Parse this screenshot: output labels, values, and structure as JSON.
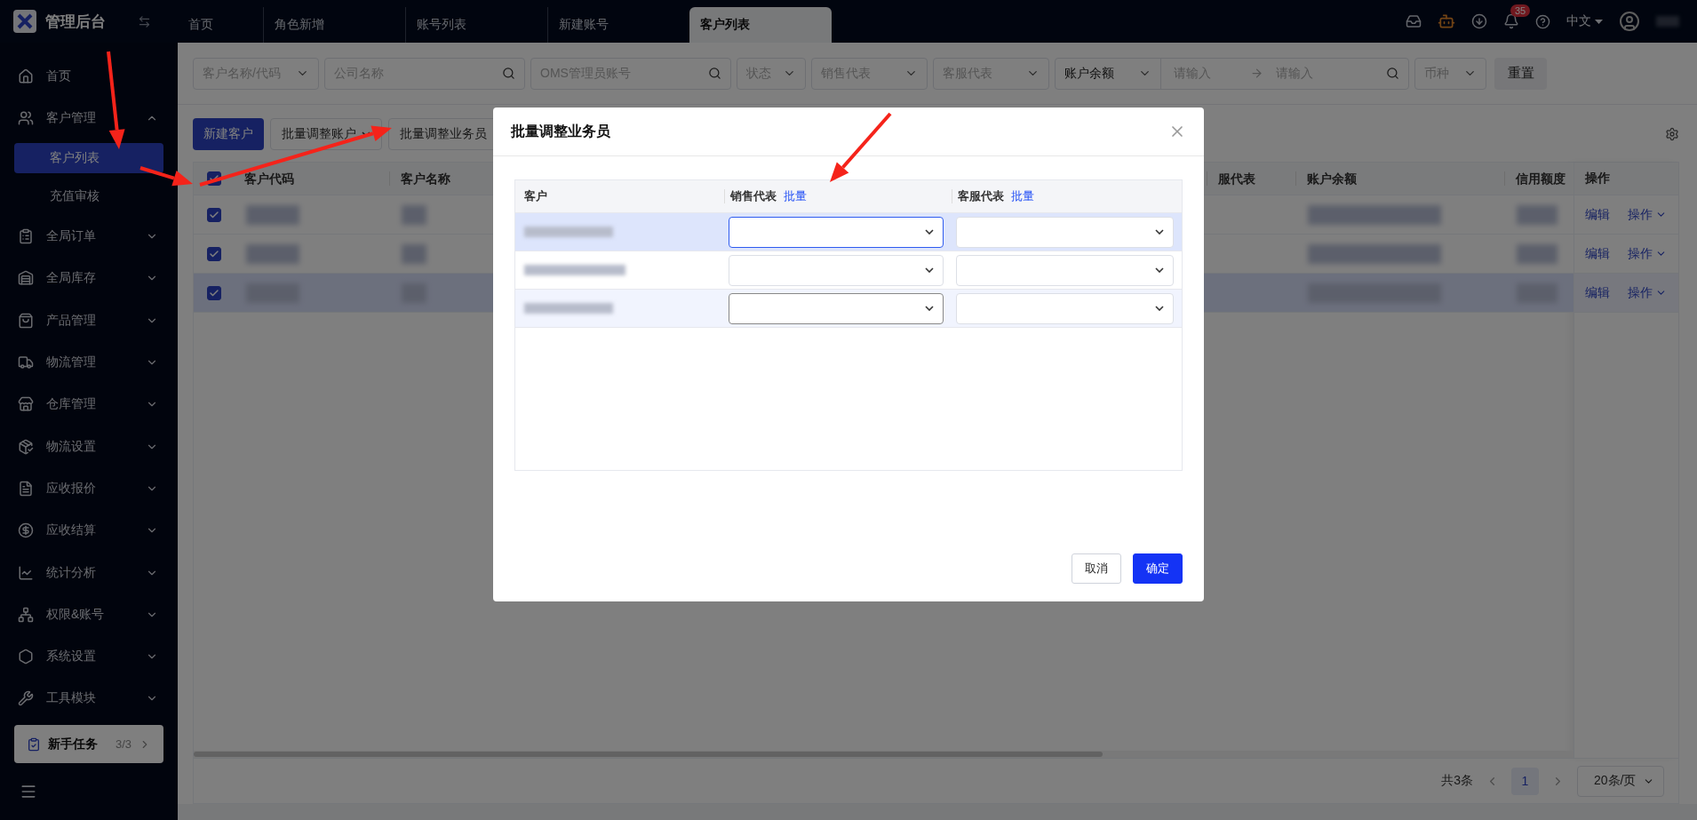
{
  "topbar": {
    "title": "管理后台",
    "tabs": [
      {
        "label": "首页",
        "selected": false
      },
      {
        "label": "角色新增",
        "selected": false
      },
      {
        "label": "账号列表",
        "selected": false
      },
      {
        "label": "新建账号",
        "selected": false
      },
      {
        "label": "客户列表",
        "selected": true
      }
    ],
    "notification_count": "35",
    "language": "中文"
  },
  "sidebar": {
    "items": [
      {
        "kind": "link",
        "label": "首页"
      },
      {
        "kind": "group",
        "label": "客户管理",
        "expanded": true,
        "children": [
          {
            "label": "客户列表",
            "selected": true
          },
          {
            "label": "充值审核",
            "selected": false
          }
        ]
      },
      {
        "kind": "group",
        "label": "全局订单",
        "expanded": false
      },
      {
        "kind": "group",
        "label": "全局库存",
        "expanded": false
      },
      {
        "kind": "group",
        "label": "产品管理",
        "expanded": false
      },
      {
        "kind": "group",
        "label": "物流管理",
        "expanded": false
      },
      {
        "kind": "group",
        "label": "仓库管理",
        "expanded": false
      },
      {
        "kind": "group",
        "label": "物流设置",
        "expanded": false
      },
      {
        "kind": "group",
        "label": "应收报价",
        "expanded": false
      },
      {
        "kind": "group",
        "label": "应收结算",
        "expanded": false
      },
      {
        "kind": "group",
        "label": "统计分析",
        "expanded": false
      },
      {
        "kind": "group",
        "label": "权限&账号",
        "expanded": false
      },
      {
        "kind": "group",
        "label": "系统设置",
        "expanded": false
      },
      {
        "kind": "group",
        "label": "工具模块",
        "expanded": false
      }
    ],
    "task": {
      "label": "新手任务",
      "progress": "3/3"
    }
  },
  "filters": [
    {
      "kind": "select",
      "placeholder": "客户名称/代码"
    },
    {
      "kind": "search",
      "placeholder": "公司名称"
    },
    {
      "kind": "search",
      "placeholder": "OMS管理员账号"
    },
    {
      "kind": "select",
      "placeholder": "状态"
    },
    {
      "kind": "select",
      "placeholder": "销售代表"
    },
    {
      "kind": "select",
      "placeholder": "客服代表"
    },
    {
      "kind": "range",
      "value": "账户余额",
      "from_placeholder": "请输入",
      "to_placeholder": "请输入"
    },
    {
      "kind": "select",
      "placeholder": "币种"
    }
  ],
  "reset_button": "重置",
  "toolbar": [
    {
      "kind": "primary",
      "label": "新建客户"
    },
    {
      "kind": "dropdown",
      "label": "批量调整账户"
    },
    {
      "kind": "plain",
      "label": "批量调整业务员"
    }
  ],
  "table": {
    "all_checked": true,
    "columns": [
      "客户代码",
      "客户名称",
      "服代表",
      "账户余额",
      "信用额度"
    ],
    "action_column": "操作",
    "rows": [
      {
        "checked": true,
        "hovered": false,
        "actions": [
          "编辑",
          "操作"
        ]
      },
      {
        "checked": true,
        "hovered": false,
        "actions": [
          "编辑",
          "操作"
        ]
      },
      {
        "checked": true,
        "hovered": true,
        "actions": [
          "编辑",
          "操作"
        ]
      }
    ]
  },
  "pagination": {
    "total": "共3条",
    "pages": [
      {
        "label": "1",
        "selected": true
      }
    ],
    "page_size": "20条/页"
  },
  "dialog": {
    "title": "批量调整业务员",
    "columns": [
      {
        "label": "客户"
      },
      {
        "label": "销售代表",
        "action": "批量"
      },
      {
        "label": "客服代表",
        "action": "批量"
      }
    ],
    "rows": [
      {
        "selected": true,
        "hovered": false,
        "selects": [
          {
            "focused": true,
            "hovered": false
          },
          {
            "focused": false,
            "hovered": false
          }
        ]
      },
      {
        "selected": false,
        "hovered": false,
        "selects": [
          {
            "focused": false,
            "hovered": false
          },
          {
            "focused": false,
            "hovered": false
          }
        ]
      },
      {
        "selected": false,
        "hovered": true,
        "selects": [
          {
            "focused": false,
            "hovered": true
          },
          {
            "focused": false,
            "hovered": false
          }
        ]
      }
    ],
    "cancel_button": "取消",
    "ok_button": "确定"
  }
}
